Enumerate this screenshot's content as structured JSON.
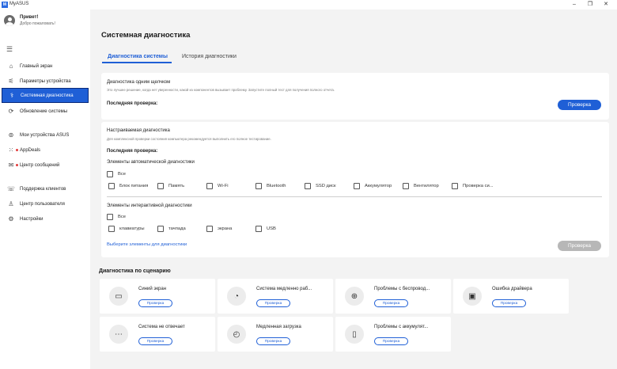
{
  "window": {
    "app_title": "MyASUS",
    "logo_text": "M",
    "controls": {
      "minimize": "–",
      "maximize": "❐",
      "close": "✕"
    }
  },
  "sidebar": {
    "greeting": "Привет!",
    "greeting_sub": "Добро пожаловать!",
    "menu_icon": "☰",
    "items": [
      {
        "label": "Главный экран",
        "icon": "⌂"
      },
      {
        "label": "Параметры устройства",
        "icon": "⚟"
      },
      {
        "label": "Системная диагностика",
        "icon": "⚕"
      },
      {
        "label": "Обновление системы",
        "icon": "⟳"
      },
      {
        "label": "Мои устройства ASUS",
        "icon": "⊚"
      },
      {
        "label": "AppDeals",
        "icon": "⁙"
      },
      {
        "label": "Центр сообщений",
        "icon": "✉"
      },
      {
        "label": "Поддержка клиентов",
        "icon": "☏"
      },
      {
        "label": "Центр пользователя",
        "icon": "♙"
      },
      {
        "label": "Настройки",
        "icon": "⚙"
      }
    ]
  },
  "main": {
    "title": "Системная диагностика",
    "tabs": [
      {
        "label": "Диагностика системы"
      },
      {
        "label": "История диагностики"
      }
    ],
    "one_click": {
      "title": "Диагностика одним щелчком",
      "desc": "Это лучшее решение, когда нет уверенности, какой из компонентов вызывает проблему. Запустите полный тест для получения полного отчета.",
      "last_check": "Последняя проверка:",
      "button": "Проверка"
    },
    "custom": {
      "title": "Настраиваемая диагностика",
      "desc": "Для комплексной проверки состояния компьютера рекомендуется выполнить его полное тестирование.",
      "last_check": "Последняя проверка:",
      "auto_label": "Элементы автоматической диагностики",
      "all_label": "Все",
      "auto_items": [
        "Блок питания",
        "Память",
        "Wi-Fi",
        "Bluetooth",
        "SSD диск",
        "Аккумулятор",
        "Вентилятор",
        "Проверка си..."
      ],
      "interactive_label": "Элементы интерактивной диагностики",
      "interactive_all": "Все",
      "interactive_items": [
        "клавиатуры",
        "тачпада",
        "экрана",
        "USB"
      ],
      "select_link": "Выберите элементы для диагностики",
      "button": "Проверка"
    },
    "scenario": {
      "title": "Диагностика по сценарию",
      "button_label": "Проверка",
      "items": [
        {
          "title": "Синий экран",
          "icon": "▭"
        },
        {
          "title": "Система медленно раб...",
          "icon": "◔"
        },
        {
          "title": "Проблемы с беспровод...",
          "icon": "⊕"
        },
        {
          "title": "Ошибка драйвера",
          "icon": "▣"
        },
        {
          "title": "Система не отвечает",
          "icon": "⋯"
        },
        {
          "title": "Медленная загрузка",
          "icon": "◴"
        },
        {
          "title": "Проблемы с аккумулят...",
          "icon": "▯"
        }
      ]
    }
  }
}
